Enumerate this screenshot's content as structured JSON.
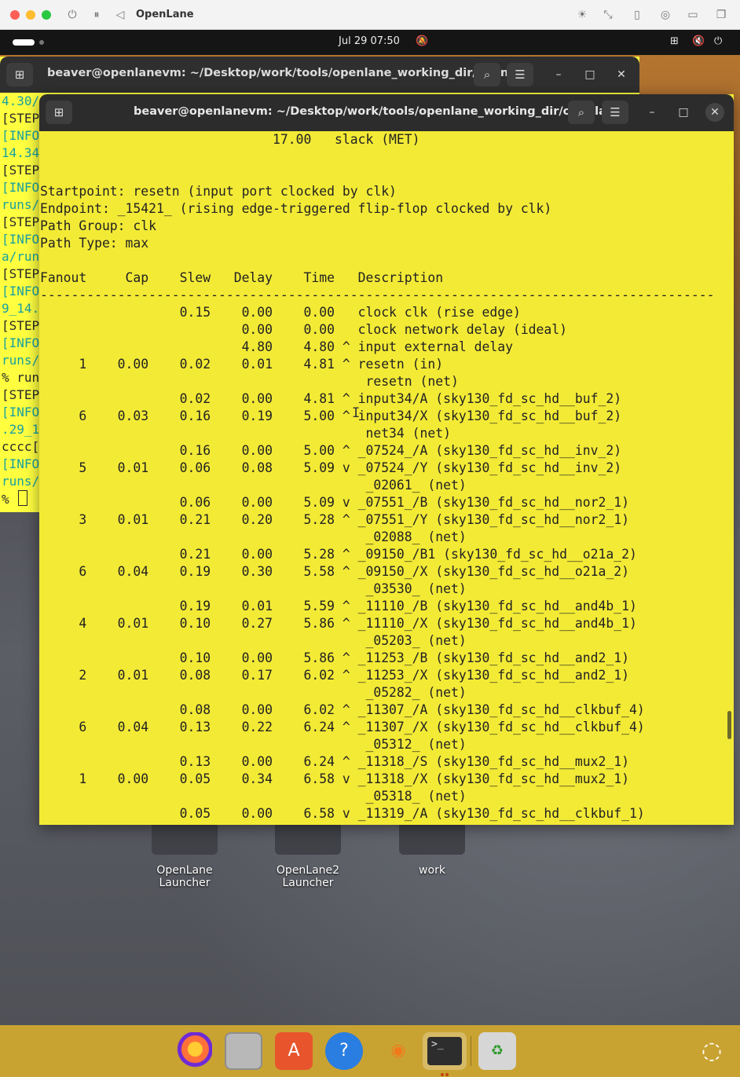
{
  "host_window": {
    "title": "OpenLane",
    "controls": [
      "power-icon",
      "pause-icon",
      "back-icon"
    ],
    "right_icons": [
      "brightness-icon",
      "resize-icon",
      "usb-icon",
      "network-share-icon",
      "folder-icon",
      "windows-icon"
    ]
  },
  "topbar": {
    "clock": "Jul 29  07:50"
  },
  "desktop": {
    "launchers": [
      {
        "label": "OpenLane Launcher"
      },
      {
        "label": "OpenLane2 Launcher"
      },
      {
        "label": "work"
      }
    ]
  },
  "back_terminal": {
    "title": "beaver@openlanevm: ~/Desktop/work/tools/openlane_working_dir/openl...",
    "lines": [
      {
        "text": "4.30/",
        "kind": "info"
      },
      {
        "text": "[STEP",
        "kind": "plain"
      },
      {
        "text": "[INFO",
        "kind": "info"
      },
      {
        "text": "14.34",
        "kind": "info"
      },
      {
        "text": "[STEP 12]",
        "kind": "plain"
      },
      {
        "text": "[INFO",
        "kind": "info"
      },
      {
        "text": "runs/",
        "kind": "info"
      },
      {
        "text": "[STEP",
        "kind": "plain"
      },
      {
        "text": "[INFO",
        "kind": "info"
      },
      {
        "text": "a/run",
        "kind": "info"
      },
      {
        "text": "[STEP",
        "kind": "plain"
      },
      {
        "text": "[INFO",
        "kind": "info"
      },
      {
        "text": "9_14.",
        "kind": "info"
      },
      {
        "text": "[STEP 15]",
        "kind": "plain"
      },
      {
        "text": "[INFO",
        "kind": "info"
      },
      {
        "text": "runs/",
        "kind": "info"
      },
      {
        "text": "% run_cts",
        "kind": "plain"
      },
      {
        "text": "[STEP 16]",
        "kind": "plain"
      },
      {
        "text": "[INFO",
        "kind": "info"
      },
      {
        "text": ".29_1",
        "kind": "info"
      },
      {
        "text": "cccc[STEP 17]",
        "kind": "plain"
      },
      {
        "text": "[INFO",
        "kind": "info"
      },
      {
        "text": "runs/",
        "kind": "info"
      },
      {
        "text": "% ",
        "kind": "cursor"
      }
    ]
  },
  "front_terminal": {
    "title": "beaver@openlanevm: ~/Desktop/work/tools/openlane_working_dir/openlane",
    "lines": [
      "                              17.00   slack (MET)",
      "",
      "",
      "Startpoint: resetn (input port clocked by clk)",
      "Endpoint: _15421_ (rising edge-triggered flip-flop clocked by clk)",
      "Path Group: clk",
      "Path Type: max",
      "",
      "Fanout     Cap    Slew   Delay    Time   Description",
      "---------------------------------------------------------------------------------------",
      "                  0.15    0.00    0.00   clock clk (rise edge)",
      "                          0.00    0.00   clock network delay (ideal)",
      "                          4.80    4.80 ^ input external delay",
      "     1    0.00    0.02    0.01    4.81 ^ resetn (in)",
      "                                          resetn (net)",
      "                  0.02    0.00    4.81 ^ input34/A (sky130_fd_sc_hd__buf_2)",
      "     6    0.03    0.16    0.19    5.00 ^ input34/X (sky130_fd_sc_hd__buf_2)",
      "                                          net34 (net)",
      "                  0.16    0.00    5.00 ^ _07524_/A (sky130_fd_sc_hd__inv_2)",
      "     5    0.01    0.06    0.08    5.09 v _07524_/Y (sky130_fd_sc_hd__inv_2)",
      "                                          _02061_ (net)",
      "                  0.06    0.00    5.09 v _07551_/B (sky130_fd_sc_hd__nor2_1)",
      "     3    0.01    0.21    0.20    5.28 ^ _07551_/Y (sky130_fd_sc_hd__nor2_1)",
      "                                          _02088_ (net)",
      "                  0.21    0.00    5.28 ^ _09150_/B1 (sky130_fd_sc_hd__o21a_2)",
      "     6    0.04    0.19    0.30    5.58 ^ _09150_/X (sky130_fd_sc_hd__o21a_2)",
      "                                          _03530_ (net)",
      "                  0.19    0.01    5.59 ^ _11110_/B (sky130_fd_sc_hd__and4b_1)",
      "     4    0.01    0.10    0.27    5.86 ^ _11110_/X (sky130_fd_sc_hd__and4b_1)",
      "                                          _05203_ (net)",
      "                  0.10    0.00    5.86 ^ _11253_/B (sky130_fd_sc_hd__and2_1)",
      "     2    0.01    0.08    0.17    6.02 ^ _11253_/X (sky130_fd_sc_hd__and2_1)",
      "                                          _05282_ (net)",
      "                  0.08    0.00    6.02 ^ _11307_/A (sky130_fd_sc_hd__clkbuf_4)",
      "     6    0.04    0.13    0.22    6.24 ^ _11307_/X (sky130_fd_sc_hd__clkbuf_4)",
      "                                          _05312_ (net)",
      "                  0.13    0.00    6.24 ^ _11318_/S (sky130_fd_sc_hd__mux2_1)",
      "     1    0.00    0.05    0.34    6.58 v _11318_/X (sky130_fd_sc_hd__mux2_1)",
      "                                          _05318_ (net)",
      "                  0.05    0.00    6.58 v _11319_/A (sky130_fd_sc_hd__clkbuf_1)"
    ]
  },
  "dock": {
    "items": [
      "firefox-icon",
      "files-icon",
      "app-center-icon",
      "help-icon",
      "blender-icon",
      "terminal-icon",
      "trash-icon"
    ],
    "active": "terminal-icon"
  },
  "colors": {
    "terminal_bg": "#f3ea36",
    "header_bg": "#2c2c2c",
    "dock_bg": "#c9a332"
  }
}
